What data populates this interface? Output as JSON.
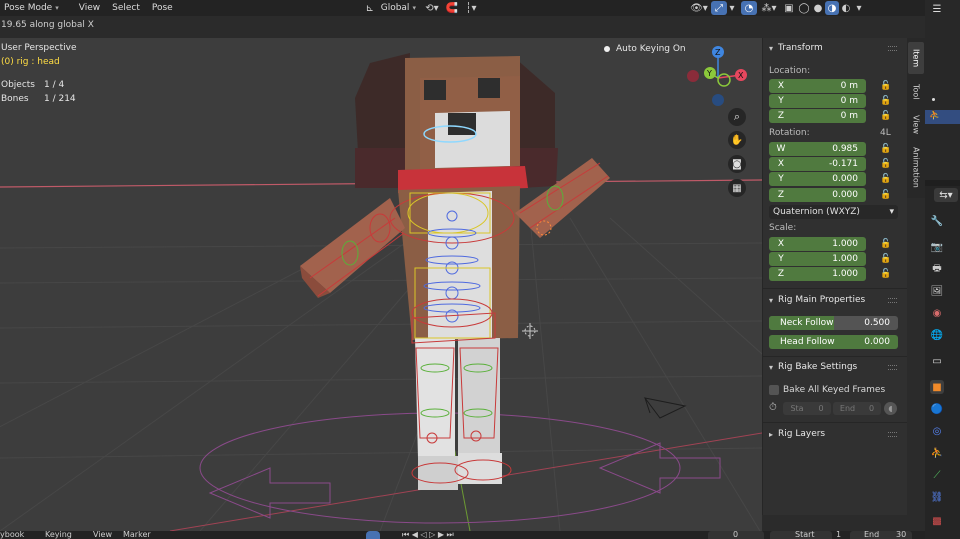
{
  "header": {
    "mode": "Pose Mode",
    "menus": [
      "View",
      "Select",
      "Pose"
    ],
    "orientation": "Global"
  },
  "status": "19.65 along global X",
  "viewport": {
    "perspective": "User Perspective",
    "active": "(0) rig : head",
    "objects_label": "Objects",
    "objects_value": "1 / 4",
    "bones_label": "Bones",
    "bones_value": "1 / 214",
    "auto_keying": "Auto Keying On",
    "gizmo": {
      "x": "X",
      "y": "Y",
      "z": "Z"
    }
  },
  "tabs": [
    "Item",
    "Tool",
    "View",
    "Animation"
  ],
  "transform": {
    "title": "Transform",
    "location_label": "Location:",
    "location": [
      {
        "axis": "X",
        "value": "0 m"
      },
      {
        "axis": "Y",
        "value": "0 m"
      },
      {
        "axis": "Z",
        "value": "0 m"
      }
    ],
    "rotation_label": "Rotation:",
    "rotation_mode_short": "4L",
    "rotation": [
      {
        "axis": "W",
        "value": "0.985"
      },
      {
        "axis": "X",
        "value": "-0.171"
      },
      {
        "axis": "Y",
        "value": "0.000"
      },
      {
        "axis": "Z",
        "value": "0.000"
      }
    ],
    "rotation_mode": "Quaternion (WXYZ)",
    "scale_label": "Scale:",
    "scale": [
      {
        "axis": "X",
        "value": "1.000"
      },
      {
        "axis": "Y",
        "value": "1.000"
      },
      {
        "axis": "Z",
        "value": "1.000"
      }
    ]
  },
  "rig_main": {
    "title": "Rig Main Properties",
    "neck_follow_label": "Neck Follow",
    "neck_follow_value": "0.500",
    "neck_follow_fraction": 0.5,
    "head_follow_label": "Head Follow",
    "head_follow_value": "0.000",
    "head_follow_fraction": 0.0
  },
  "rig_bake": {
    "title": "Rig Bake Settings",
    "bake_label": "Bake All Keyed Frames",
    "start_label": "Sta",
    "start_value": "0",
    "end_label": "End",
    "end_value": "0"
  },
  "rig_layers": {
    "title": "Rig Layers"
  },
  "bottom": {
    "left": "ybook",
    "keying": "Keying",
    "view": "View",
    "marker": "Marker",
    "frame": "0",
    "start_label": "Start",
    "start_value": "1",
    "end_label": "End",
    "end_value": "30"
  },
  "colors": {
    "field_green": "#507a3f",
    "accent_blue": "#4772b3",
    "x_axis": "#e8475e",
    "y_axis": "#8bc83b",
    "z_axis": "#3f86e0",
    "viewport_bg": "#3d3d3d"
  }
}
